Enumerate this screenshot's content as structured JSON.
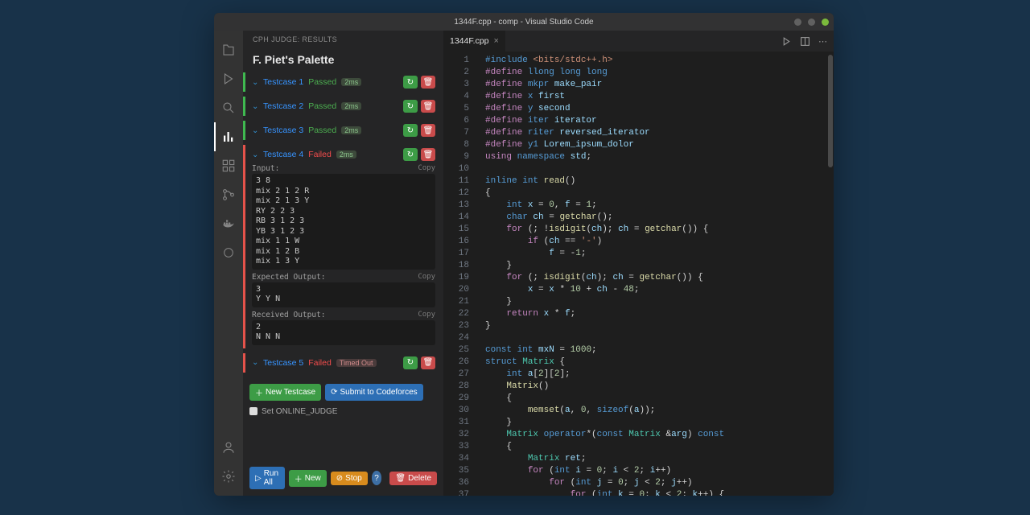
{
  "titlebar": {
    "title": "1344F.cpp - comp - Visual Studio Code"
  },
  "sidebar": {
    "header": "CPH JUDGE: RESULTS",
    "problem": "F. Piet's Palette",
    "testcases": [
      {
        "name": "Testcase 1",
        "status": "Passed",
        "passed": true,
        "time": "2ms",
        "expanded": false
      },
      {
        "name": "Testcase 2",
        "status": "Passed",
        "passed": true,
        "time": "2ms",
        "expanded": false
      },
      {
        "name": "Testcase 3",
        "status": "Passed",
        "passed": true,
        "time": "2ms",
        "expanded": false
      },
      {
        "name": "Testcase 4",
        "status": "Failed",
        "passed": false,
        "time": "2ms",
        "expanded": true,
        "input_label": "Input:",
        "expected_label": "Expected Output:",
        "received_label": "Received Output:",
        "copy": "Copy",
        "input": "3 8\nmix 2 1 2 R\nmix 2 1 3 Y\nRY 2 2 3\nRB 3 1 2 3\nYB 3 1 2 3\nmix 1 1 W\nmix 1 2 B\nmix 1 3 Y",
        "expected": "3\nY Y N",
        "received": "2\nN N N"
      },
      {
        "name": "Testcase 5",
        "status": "Failed",
        "passed": false,
        "time": "Timed Out",
        "expanded": false
      }
    ],
    "new_testcase": "New Testcase",
    "submit": "Submit to Codeforces",
    "online_judge": "Set ONLINE_JUDGE",
    "footer": {
      "run_all": "Run All",
      "new": "New",
      "stop": "Stop",
      "delete": "Delete"
    }
  },
  "tabs": {
    "file": "1344F.cpp"
  },
  "code_lines": [
    [
      [
        "inc",
        "#include "
      ],
      [
        "incpath",
        "<bits/stdc++.h>"
      ]
    ],
    [
      [
        "def",
        "#define "
      ],
      [
        "macro",
        "llong "
      ],
      [
        "kw",
        "long long"
      ]
    ],
    [
      [
        "def",
        "#define "
      ],
      [
        "macro",
        "mkpr "
      ],
      [
        "id",
        "make_pair"
      ]
    ],
    [
      [
        "def",
        "#define "
      ],
      [
        "macro",
        "x "
      ],
      [
        "id",
        "first"
      ]
    ],
    [
      [
        "def",
        "#define "
      ],
      [
        "macro",
        "y "
      ],
      [
        "id",
        "second"
      ]
    ],
    [
      [
        "def",
        "#define "
      ],
      [
        "macro",
        "iter "
      ],
      [
        "id",
        "iterator"
      ]
    ],
    [
      [
        "def",
        "#define "
      ],
      [
        "macro",
        "riter "
      ],
      [
        "id",
        "reversed_iterator"
      ]
    ],
    [
      [
        "def",
        "#define "
      ],
      [
        "macro",
        "y1 "
      ],
      [
        "id",
        "Lorem_ipsum_dolor"
      ]
    ],
    [
      [
        "ctrl",
        "using "
      ],
      [
        "kw",
        "namespace "
      ],
      [
        "id",
        "std"
      ],
      [
        "op",
        ";"
      ]
    ],
    [],
    [
      [
        "kw",
        "inline "
      ],
      [
        "kw",
        "int "
      ],
      [
        "fn",
        "read"
      ],
      [
        "op",
        "()"
      ]
    ],
    [
      [
        "op",
        "{"
      ]
    ],
    [
      [
        "op",
        "    "
      ],
      [
        "kw",
        "int "
      ],
      [
        "id",
        "x"
      ],
      [
        "op",
        " = "
      ],
      [
        "num",
        "0"
      ],
      [
        "op",
        ", "
      ],
      [
        "id",
        "f"
      ],
      [
        "op",
        " = "
      ],
      [
        "num",
        "1"
      ],
      [
        "op",
        ";"
      ]
    ],
    [
      [
        "op",
        "    "
      ],
      [
        "kw",
        "char "
      ],
      [
        "id",
        "ch"
      ],
      [
        "op",
        " = "
      ],
      [
        "fn",
        "getchar"
      ],
      [
        "op",
        "();"
      ]
    ],
    [
      [
        "op",
        "    "
      ],
      [
        "ctrl",
        "for "
      ],
      [
        "op",
        "(; !"
      ],
      [
        "fn",
        "isdigit"
      ],
      [
        "op",
        "("
      ],
      [
        "id",
        "ch"
      ],
      [
        "op",
        "); "
      ],
      [
        "id",
        "ch"
      ],
      [
        "op",
        " = "
      ],
      [
        "fn",
        "getchar"
      ],
      [
        "op",
        "()) {"
      ]
    ],
    [
      [
        "op",
        "        "
      ],
      [
        "ctrl",
        "if "
      ],
      [
        "op",
        "("
      ],
      [
        "id",
        "ch"
      ],
      [
        "op",
        " == "
      ],
      [
        "str",
        "'-'"
      ],
      [
        "op",
        ")"
      ]
    ],
    [
      [
        "op",
        "            "
      ],
      [
        "id",
        "f"
      ],
      [
        "op",
        " = -"
      ],
      [
        "num",
        "1"
      ],
      [
        "op",
        ";"
      ]
    ],
    [
      [
        "op",
        "    }"
      ]
    ],
    [
      [
        "op",
        "    "
      ],
      [
        "ctrl",
        "for "
      ],
      [
        "op",
        "(; "
      ],
      [
        "fn",
        "isdigit"
      ],
      [
        "op",
        "("
      ],
      [
        "id",
        "ch"
      ],
      [
        "op",
        "); "
      ],
      [
        "id",
        "ch"
      ],
      [
        "op",
        " = "
      ],
      [
        "fn",
        "getchar"
      ],
      [
        "op",
        "()) {"
      ]
    ],
    [
      [
        "op",
        "        "
      ],
      [
        "id",
        "x"
      ],
      [
        "op",
        " = "
      ],
      [
        "id",
        "x"
      ],
      [
        "op",
        " * "
      ],
      [
        "num",
        "10"
      ],
      [
        "op",
        " + "
      ],
      [
        "id",
        "ch"
      ],
      [
        "op",
        " - "
      ],
      [
        "num",
        "48"
      ],
      [
        "op",
        ";"
      ]
    ],
    [
      [
        "op",
        "    }"
      ]
    ],
    [
      [
        "op",
        "    "
      ],
      [
        "ctrl",
        "return "
      ],
      [
        "id",
        "x"
      ],
      [
        "op",
        " * "
      ],
      [
        "id",
        "f"
      ],
      [
        "op",
        ";"
      ]
    ],
    [
      [
        "op",
        "}"
      ]
    ],
    [],
    [
      [
        "kw",
        "const "
      ],
      [
        "kw",
        "int "
      ],
      [
        "id",
        "mxN"
      ],
      [
        "op",
        " = "
      ],
      [
        "num",
        "1000"
      ],
      [
        "op",
        ";"
      ]
    ],
    [
      [
        "kw",
        "struct "
      ],
      [
        "type",
        "Matrix"
      ],
      [
        "op",
        " {"
      ]
    ],
    [
      [
        "op",
        "    "
      ],
      [
        "kw",
        "int "
      ],
      [
        "id",
        "a"
      ],
      [
        "op",
        "["
      ],
      [
        "num",
        "2"
      ],
      [
        "op",
        "]["
      ],
      [
        "num",
        "2"
      ],
      [
        "op",
        "];"
      ]
    ],
    [
      [
        "op",
        "    "
      ],
      [
        "fn",
        "Matrix"
      ],
      [
        "op",
        "()"
      ]
    ],
    [
      [
        "op",
        "    {"
      ]
    ],
    [
      [
        "op",
        "        "
      ],
      [
        "fn",
        "memset"
      ],
      [
        "op",
        "("
      ],
      [
        "id",
        "a"
      ],
      [
        "op",
        ", "
      ],
      [
        "num",
        "0"
      ],
      [
        "op",
        ", "
      ],
      [
        "kw",
        "sizeof"
      ],
      [
        "op",
        "("
      ],
      [
        "id",
        "a"
      ],
      [
        "op",
        "));"
      ]
    ],
    [
      [
        "op",
        "    }"
      ]
    ],
    [
      [
        "op",
        "    "
      ],
      [
        "type",
        "Matrix "
      ],
      [
        "kw",
        "operator"
      ],
      [
        "op",
        "*("
      ],
      [
        "kw",
        "const "
      ],
      [
        "type",
        "Matrix "
      ],
      [
        "op",
        "&"
      ],
      [
        "id",
        "arg"
      ],
      [
        "op",
        ") "
      ],
      [
        "kw",
        "const"
      ]
    ],
    [
      [
        "op",
        "    {"
      ]
    ],
    [
      [
        "op",
        "        "
      ],
      [
        "type",
        "Matrix "
      ],
      [
        "id",
        "ret"
      ],
      [
        "op",
        ";"
      ]
    ],
    [
      [
        "op",
        "        "
      ],
      [
        "ctrl",
        "for "
      ],
      [
        "op",
        "("
      ],
      [
        "kw",
        "int "
      ],
      [
        "id",
        "i"
      ],
      [
        "op",
        " = "
      ],
      [
        "num",
        "0"
      ],
      [
        "op",
        "; "
      ],
      [
        "id",
        "i"
      ],
      [
        "op",
        " < "
      ],
      [
        "num",
        "2"
      ],
      [
        "op",
        "; "
      ],
      [
        "id",
        "i"
      ],
      [
        "op",
        "++)"
      ]
    ],
    [
      [
        "op",
        "            "
      ],
      [
        "ctrl",
        "for "
      ],
      [
        "op",
        "("
      ],
      [
        "kw",
        "int "
      ],
      [
        "id",
        "j"
      ],
      [
        "op",
        " = "
      ],
      [
        "num",
        "0"
      ],
      [
        "op",
        "; "
      ],
      [
        "id",
        "j"
      ],
      [
        "op",
        " < "
      ],
      [
        "num",
        "2"
      ],
      [
        "op",
        "; "
      ],
      [
        "id",
        "j"
      ],
      [
        "op",
        "++)"
      ]
    ],
    [
      [
        "op",
        "                "
      ],
      [
        "ctrl",
        "for "
      ],
      [
        "op",
        "("
      ],
      [
        "kw",
        "int "
      ],
      [
        "id",
        "k"
      ],
      [
        "op",
        " = "
      ],
      [
        "num",
        "0"
      ],
      [
        "op",
        "; "
      ],
      [
        "id",
        "k"
      ],
      [
        "op",
        " < "
      ],
      [
        "num",
        "2"
      ],
      [
        "op",
        "; "
      ],
      [
        "id",
        "k"
      ],
      [
        "op",
        "++) {"
      ]
    ]
  ]
}
